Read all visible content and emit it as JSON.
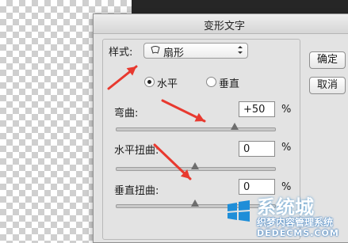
{
  "dialog": {
    "title": "变形文字",
    "style_label": "样式:",
    "style_value": "扇形",
    "orientation": {
      "horizontal_label": "水平",
      "vertical_label": "垂直",
      "selected": "horizontal"
    },
    "bend": {
      "label": "弯曲:",
      "value": "+50",
      "unit": "%",
      "level_percent": 50
    },
    "h_distortion": {
      "label": "水平扭曲:",
      "value": "0",
      "unit": "%",
      "level_percent": 0
    },
    "v_distortion": {
      "label": "垂直扭曲:",
      "value": "0",
      "unit": "%",
      "level_percent": 0
    },
    "ok_label": "确定",
    "cancel_label": "取消"
  },
  "watermark": {
    "name": "系统城",
    "slogan": "织梦内容管理系统",
    "url": "DEDECMS.COM"
  },
  "colors": {
    "annotation_arrow": "#e8392f",
    "dialog_bg": "#e3e3e3"
  }
}
